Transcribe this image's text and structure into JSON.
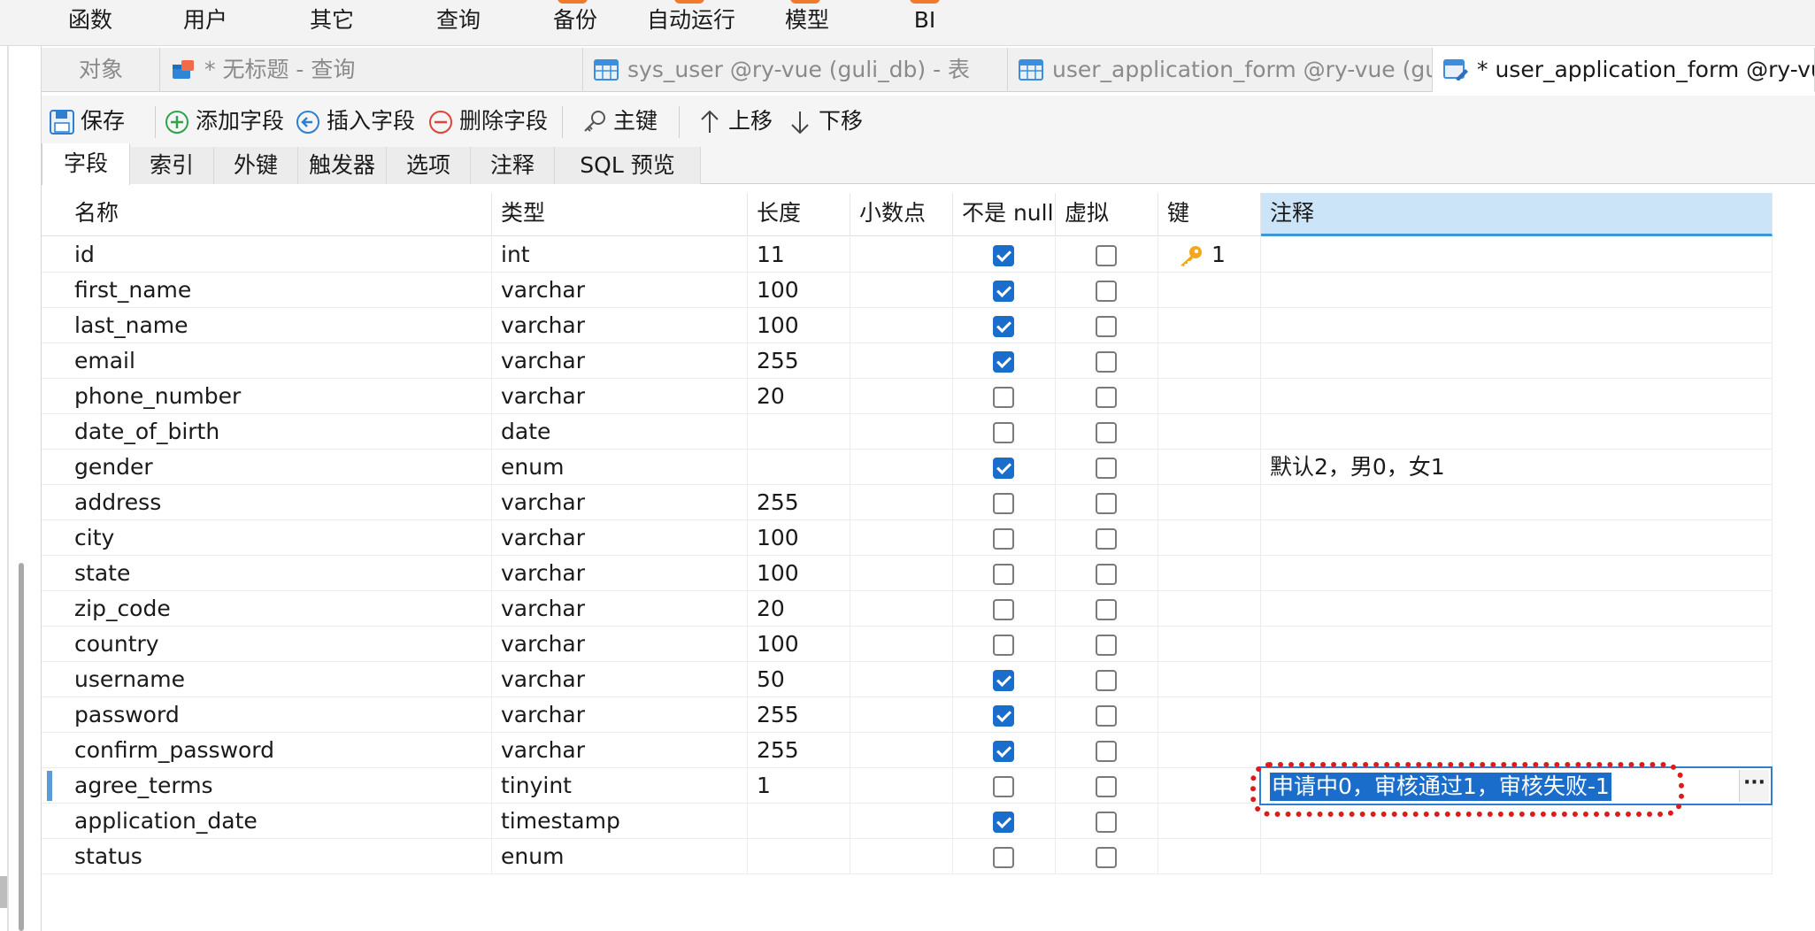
{
  "menu": {
    "items": [
      "函数",
      "用户",
      "其它",
      "查询",
      "备份",
      "自动运行",
      "模型",
      "BI"
    ],
    "badge_color": "#f07a2c"
  },
  "doc_tabs": [
    {
      "label": "对象",
      "icon": "objects",
      "active": false
    },
    {
      "label": "* 无标题 - 查询",
      "icon": "query-icon",
      "active": false
    },
    {
      "label": "sys_user @ry-vue (guli_db) - 表",
      "icon": "table-icon",
      "active": false
    },
    {
      "label": "user_application_form @ry-vue (gul...",
      "icon": "table-icon",
      "active": false
    },
    {
      "label": "* user_application_form @ry-vue",
      "icon": "table-edit-icon",
      "active": true
    }
  ],
  "toolbar": {
    "save": "保存",
    "add_field": "添加字段",
    "insert_field": "插入字段",
    "delete_field": "删除字段",
    "primary_key": "主键",
    "move_up": "上移",
    "move_down": "下移"
  },
  "sub_tabs": [
    "字段",
    "索引",
    "外键",
    "触发器",
    "选项",
    "注释",
    "SQL 预览"
  ],
  "grid": {
    "headers": [
      "名称",
      "类型",
      "长度",
      "小数点",
      "不是 null",
      "虚拟",
      "键",
      "注释"
    ],
    "rows": [
      {
        "name": "id",
        "type": "int",
        "length": "11",
        "decimals": "",
        "not_null": true,
        "virtual": false,
        "key": "1",
        "comment": ""
      },
      {
        "name": "first_name",
        "type": "varchar",
        "length": "100",
        "decimals": "",
        "not_null": true,
        "virtual": false,
        "key": "",
        "comment": ""
      },
      {
        "name": "last_name",
        "type": "varchar",
        "length": "100",
        "decimals": "",
        "not_null": true,
        "virtual": false,
        "key": "",
        "comment": ""
      },
      {
        "name": "email",
        "type": "varchar",
        "length": "255",
        "decimals": "",
        "not_null": true,
        "virtual": false,
        "key": "",
        "comment": ""
      },
      {
        "name": "phone_number",
        "type": "varchar",
        "length": "20",
        "decimals": "",
        "not_null": false,
        "virtual": false,
        "key": "",
        "comment": ""
      },
      {
        "name": "date_of_birth",
        "type": "date",
        "length": "",
        "decimals": "",
        "not_null": false,
        "virtual": false,
        "key": "",
        "comment": ""
      },
      {
        "name": "gender",
        "type": "enum",
        "length": "",
        "decimals": "",
        "not_null": true,
        "virtual": false,
        "key": "",
        "comment": "默认2，男0，女1"
      },
      {
        "name": "address",
        "type": "varchar",
        "length": "255",
        "decimals": "",
        "not_null": false,
        "virtual": false,
        "key": "",
        "comment": ""
      },
      {
        "name": "city",
        "type": "varchar",
        "length": "100",
        "decimals": "",
        "not_null": false,
        "virtual": false,
        "key": "",
        "comment": ""
      },
      {
        "name": "state",
        "type": "varchar",
        "length": "100",
        "decimals": "",
        "not_null": false,
        "virtual": false,
        "key": "",
        "comment": ""
      },
      {
        "name": "zip_code",
        "type": "varchar",
        "length": "20",
        "decimals": "",
        "not_null": false,
        "virtual": false,
        "key": "",
        "comment": ""
      },
      {
        "name": "country",
        "type": "varchar",
        "length": "100",
        "decimals": "",
        "not_null": false,
        "virtual": false,
        "key": "",
        "comment": ""
      },
      {
        "name": "username",
        "type": "varchar",
        "length": "50",
        "decimals": "",
        "not_null": true,
        "virtual": false,
        "key": "",
        "comment": ""
      },
      {
        "name": "password",
        "type": "varchar",
        "length": "255",
        "decimals": "",
        "not_null": true,
        "virtual": false,
        "key": "",
        "comment": ""
      },
      {
        "name": "confirm_password",
        "type": "varchar",
        "length": "255",
        "decimals": "",
        "not_null": true,
        "virtual": false,
        "key": "",
        "comment": ""
      },
      {
        "name": "agree_terms",
        "type": "tinyint",
        "length": "1",
        "decimals": "",
        "not_null": false,
        "virtual": false,
        "key": "",
        "comment": ""
      },
      {
        "name": "application_date",
        "type": "timestamp",
        "length": "",
        "decimals": "",
        "not_null": true,
        "virtual": false,
        "key": "",
        "comment": ""
      },
      {
        "name": "status",
        "type": "enum",
        "length": "",
        "decimals": "",
        "not_null": false,
        "virtual": false,
        "key": "",
        "comment": ""
      }
    ],
    "editing_row": 15,
    "editing_value": "申请中0，审核通过1，审核失败-1",
    "editor_button": "···"
  },
  "colors": {
    "accent": "#1a6dcb",
    "selected_header": "#cce4f7",
    "annotation": "#e01a1a",
    "key": "#f2a81d"
  }
}
